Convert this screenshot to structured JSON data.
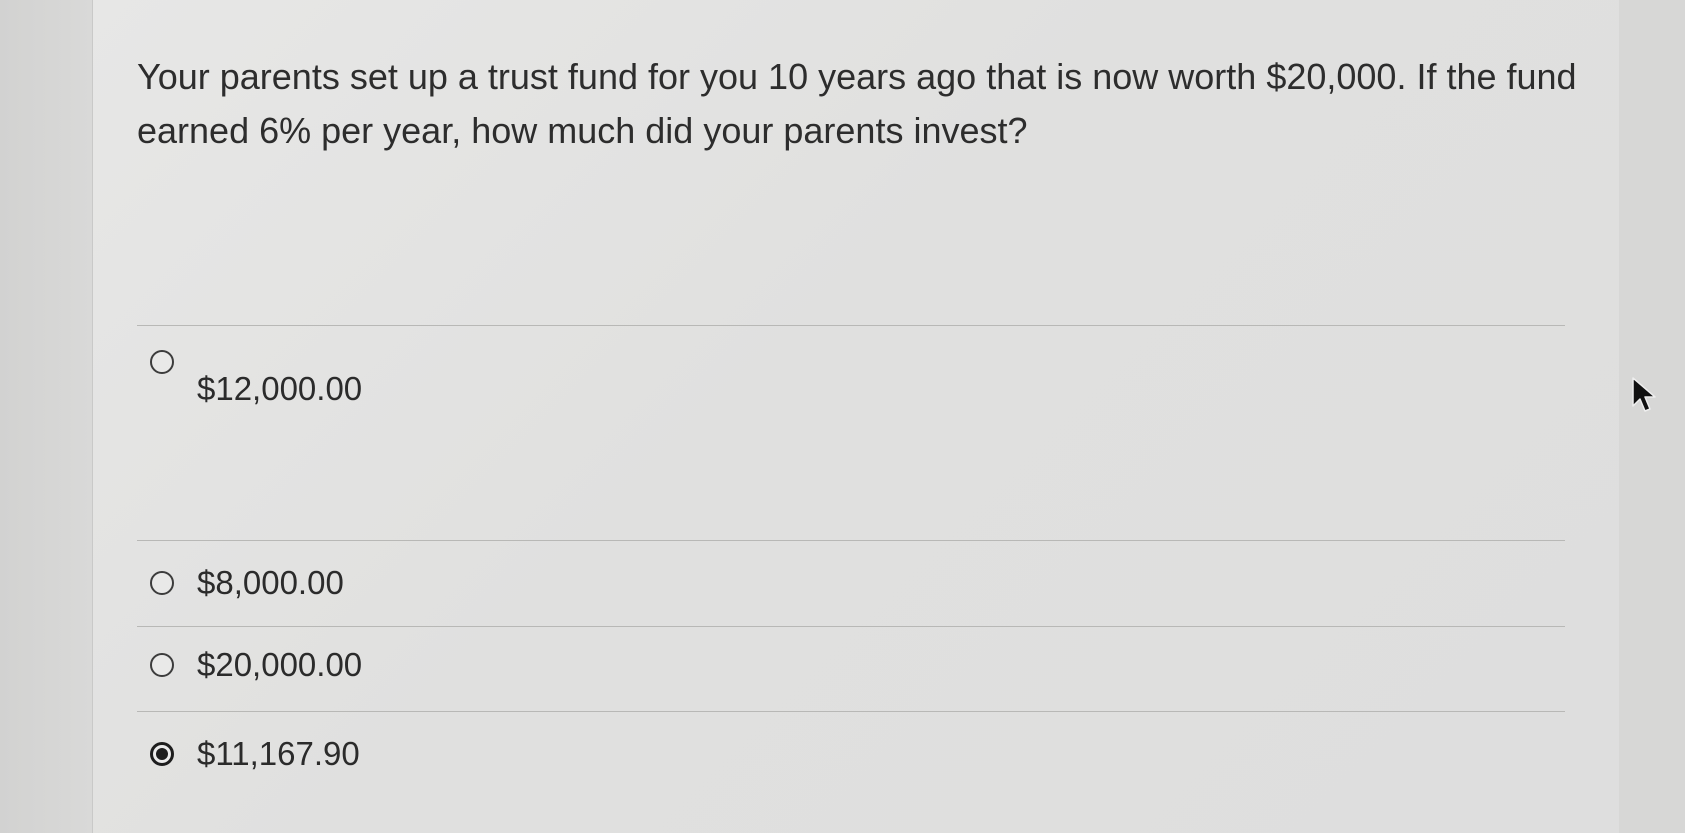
{
  "question": {
    "text": "Your parents set up a trust fund for you 10 years ago that is now worth $20,000. If the fund earned 6% per year, how much did your parents invest?"
  },
  "options": [
    {
      "label": "$12,000.00",
      "selected": false
    },
    {
      "label": "$8,000.00",
      "selected": false
    },
    {
      "label": "$20,000.00",
      "selected": false
    },
    {
      "label": "$11,167.90",
      "selected": true
    }
  ],
  "icons": {
    "radio_unselected": "radio-empty-icon",
    "radio_selected": "radio-filled-icon",
    "pointer": "mouse-pointer-icon"
  }
}
